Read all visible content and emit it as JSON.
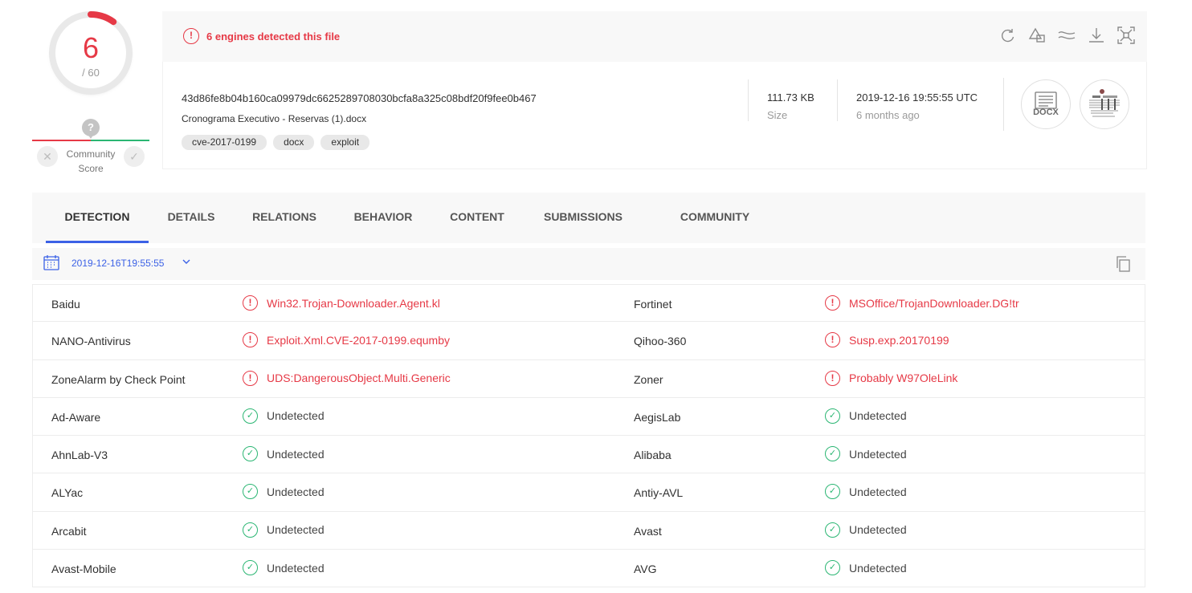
{
  "score": {
    "detected": "6",
    "total": "/ 60",
    "question_mark": "?",
    "community_label_1": "Community",
    "community_label_2": "Score",
    "downvote_glyph": "✕",
    "upvote_glyph": "✓",
    "detection_fraction": 0.1
  },
  "banner": {
    "alert_glyph": "!",
    "alert_text": "6 engines detected this file",
    "tools": [
      "reanalyze-icon",
      "similar-icon",
      "graph-icon",
      "download-icon",
      "expand-icon"
    ]
  },
  "file": {
    "hash": "43d86fe8b04b160ca09979dc6625289708030bcfa8a325c08bdf20f9fee0b467",
    "name": "Cronograma Executivo - Reservas (1).docx",
    "tags": [
      "cve-2017-0199",
      "docx",
      "exploit"
    ],
    "size_value": "111.73 KB",
    "size_label": "Size",
    "date_value": "2019-12-16 19:55:55 UTC",
    "date_relative": "6 months ago",
    "type_label": "DOCX"
  },
  "tabs": [
    "DETECTION",
    "DETAILS",
    "RELATIONS",
    "BEHAVIOR",
    "CONTENT",
    "SUBMISSIONS",
    "COMMUNITY"
  ],
  "datebar": {
    "date": "2019-12-16T19:55:55"
  },
  "results": [
    [
      {
        "engine": "Baidu",
        "verdict": "Win32.Trojan-Downloader.Agent.kl",
        "status": "bad"
      },
      {
        "engine": "Fortinet",
        "verdict": "MSOffice/TrojanDownloader.DG!tr",
        "status": "bad"
      }
    ],
    [
      {
        "engine": "NANO-Antivirus",
        "verdict": "Exploit.Xml.CVE-2017-0199.equmby",
        "status": "bad"
      },
      {
        "engine": "Qihoo-360",
        "verdict": "Susp.exp.20170199",
        "status": "bad"
      }
    ],
    [
      {
        "engine": "ZoneAlarm by Check Point",
        "verdict": "UDS:DangerousObject.Multi.Generic",
        "status": "bad"
      },
      {
        "engine": "Zoner",
        "verdict": "Probably W97OleLink",
        "status": "bad"
      }
    ],
    [
      {
        "engine": "Ad-Aware",
        "verdict": "Undetected",
        "status": "ok"
      },
      {
        "engine": "AegisLab",
        "verdict": "Undetected",
        "status": "ok"
      }
    ],
    [
      {
        "engine": "AhnLab-V3",
        "verdict": "Undetected",
        "status": "ok"
      },
      {
        "engine": "Alibaba",
        "verdict": "Undetected",
        "status": "ok"
      }
    ],
    [
      {
        "engine": "ALYac",
        "verdict": "Undetected",
        "status": "ok"
      },
      {
        "engine": "Antiy-AVL",
        "verdict": "Undetected",
        "status": "ok"
      }
    ],
    [
      {
        "engine": "Arcabit",
        "verdict": "Undetected",
        "status": "ok"
      },
      {
        "engine": "Avast",
        "verdict": "Undetected",
        "status": "ok"
      }
    ],
    [
      {
        "engine": "Avast-Mobile",
        "verdict": "Undetected",
        "status": "ok"
      },
      {
        "engine": "AVG",
        "verdict": "Undetected",
        "status": "ok"
      }
    ]
  ],
  "colors": {
    "alert": "#e63946",
    "ok": "#2bb673",
    "accent": "#3b61e6"
  }
}
